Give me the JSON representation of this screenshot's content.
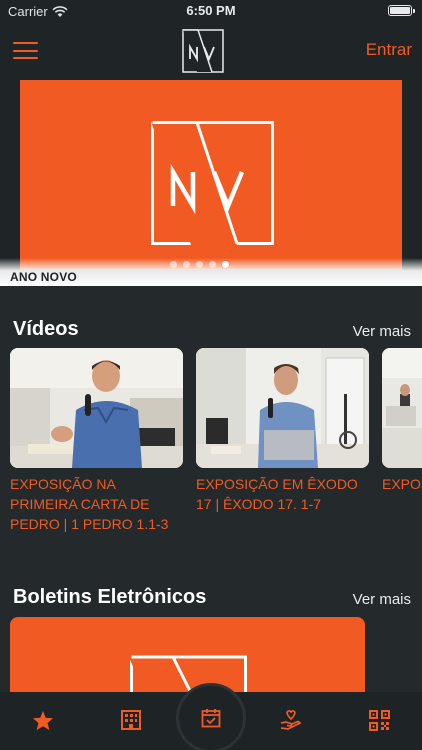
{
  "status_bar": {
    "carrier": "Carrier",
    "time": "6:50 PM"
  },
  "header": {
    "login_label": "Entrar",
    "logo_text": "NV"
  },
  "hero": {
    "caption": "ANO NOVO",
    "slides_total": 5,
    "active_slide": 5
  },
  "videos": {
    "title": "Vídeos",
    "see_more": "Ver mais",
    "items": [
      {
        "title": "EXPOSIÇÃO NA PRIMEIRA CARTA DE PEDRO | 1 PEDRO 1.1-3"
      },
      {
        "title": "EXPOSIÇÃO EM ÊXODO 17 | ÊXODO 17. 1-7"
      },
      {
        "title": "EXPOS AOS F FILIPE"
      }
    ]
  },
  "bulletins": {
    "title": "Boletins Eletrônicos",
    "see_more": "Ver mais"
  },
  "tabbar": {
    "items": [
      {
        "icon": "star-icon"
      },
      {
        "icon": "building-icon"
      },
      {
        "icon": "calendar-check-icon"
      },
      {
        "icon": "hand-heart-icon"
      },
      {
        "icon": "qr-code-icon"
      }
    ]
  },
  "colors": {
    "accent": "#f15a22",
    "background": "#242a2c",
    "bar": "#1f2527"
  }
}
